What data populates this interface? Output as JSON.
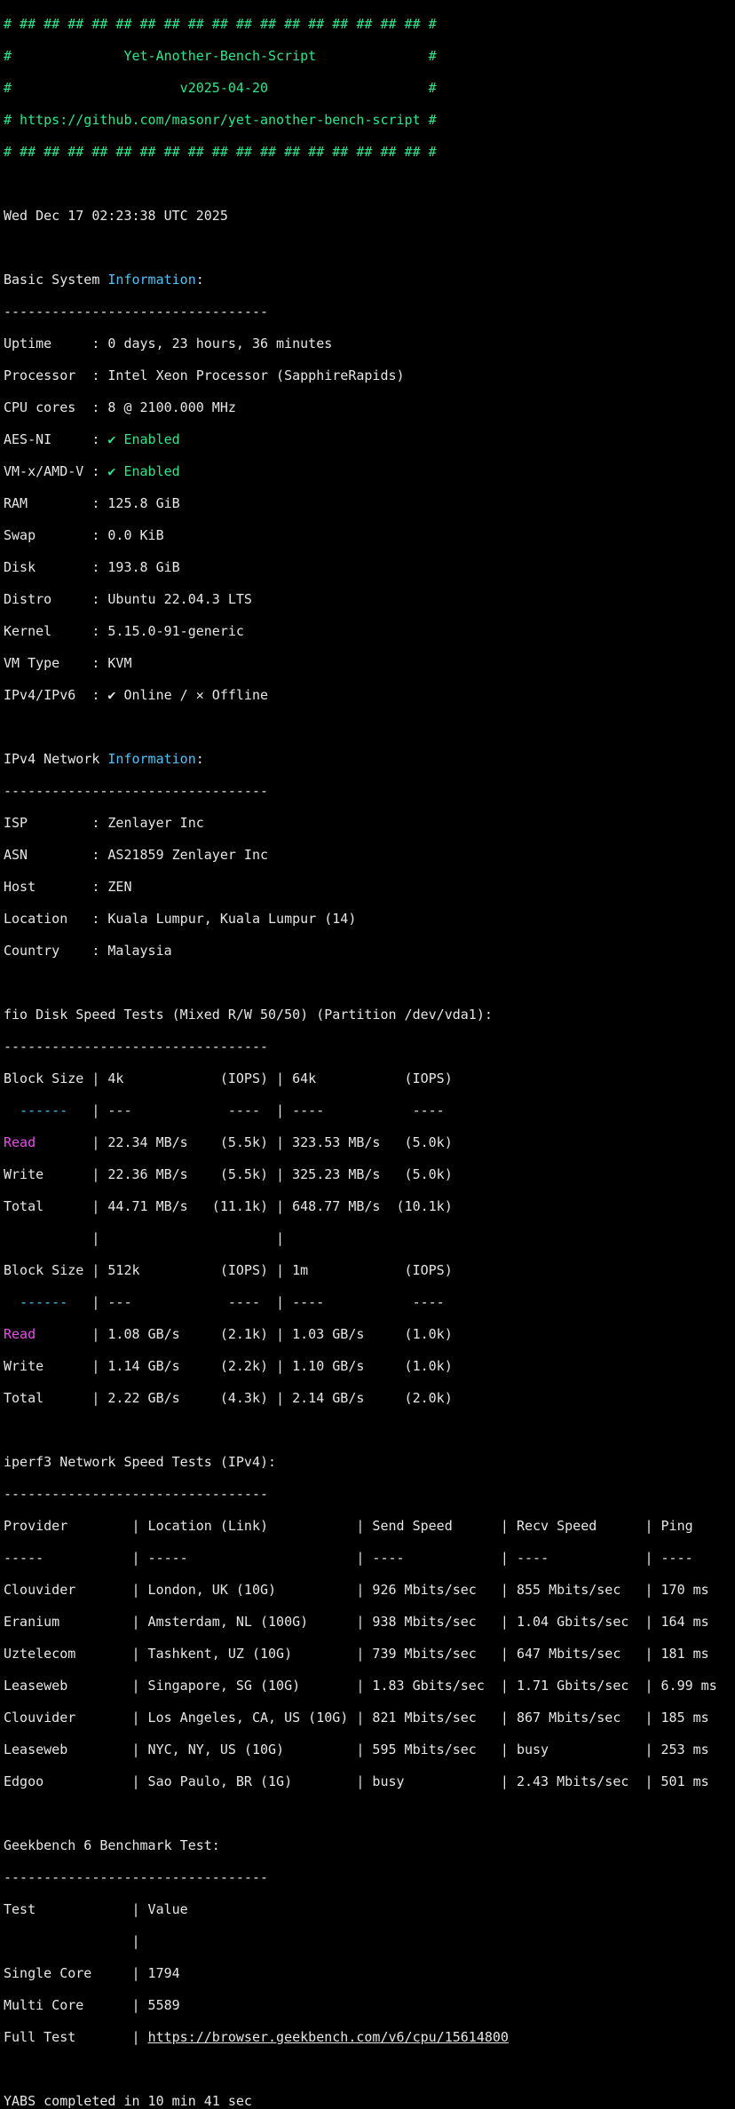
{
  "banner": {
    "border": "# ## ## ## ## ## ## ## ## ## ## ## ## ## ## ## ## ## #",
    "title_line": "#              Yet-Another-Bench-Script              #",
    "version_line": "#                     v2025-04-20                    #",
    "url_line": "# https://github.com/masonr/yet-another-bench-script #"
  },
  "date": "Wed Dec 17 02:23:38 UTC 2025",
  "separator": "---------------------------------",
  "basic": {
    "heading_prefix": "Basic System ",
    "heading_highlight": "Information",
    "heading_suffix": ":",
    "rows": [
      {
        "label": "Uptime     : ",
        "value": "0 days, 23 hours, 36 minutes"
      },
      {
        "label": "Processor  : ",
        "value": "Intel Xeon Processor (SapphireRapids)"
      },
      {
        "label": "CPU cores  : ",
        "value": "8 @ 2100.000 MHz"
      },
      {
        "label": "AES-NI     : ",
        "value": "✔ Enabled"
      },
      {
        "label": "VM-x/AMD-V : ",
        "value": "✔ Enabled"
      },
      {
        "label": "RAM        : ",
        "value": "125.8 GiB"
      },
      {
        "label": "Swap       : ",
        "value": "0.0 KiB"
      },
      {
        "label": "Disk       : ",
        "value": "193.8 GiB"
      },
      {
        "label": "Distro     : ",
        "value": "Ubuntu 22.04.3 LTS"
      },
      {
        "label": "Kernel     : ",
        "value": "5.15.0-91-generic"
      },
      {
        "label": "VM Type    : ",
        "value": "KVM"
      },
      {
        "label": "IPv4/IPv6  : ",
        "value": "✔ Online / ✕ Offline"
      }
    ]
  },
  "network": {
    "heading_prefix": "IPv4 Network ",
    "heading_highlight": "Information",
    "heading_suffix": ":",
    "rows": [
      {
        "label": "ISP        : ",
        "value": "Zenlayer Inc"
      },
      {
        "label": "ASN        : ",
        "value": "AS21859 Zenlayer Inc"
      },
      {
        "label": "Host       : ",
        "value": "ZEN"
      },
      {
        "label": "Location   : ",
        "value": "Kuala Lumpur, Kuala Lumpur (14)"
      },
      {
        "label": "Country    : ",
        "value": "Malaysia"
      }
    ]
  },
  "fio": {
    "heading": "fio Disk Speed Tests (Mixed R/W 50/50) (Partition /dev/vda1):",
    "header1": "Block Size | 4k            (IOPS) | 64k           (IOPS)",
    "dash1a": "  ------   ",
    "dash1b": "| ---            ----  | ----           ---- ",
    "read1_label": "Read",
    "read1_rest": "       | 22.34 MB/s    (5.5k) | 323.53 MB/s   (5.0k)",
    "write1": "Write      | 22.36 MB/s    (5.5k) | 325.23 MB/s   (5.0k)",
    "total1": "Total      | 44.71 MB/s   (11.1k) | 648.77 MB/s  (10.1k)",
    "spacer": "           |                      |",
    "header2": "Block Size | 512k          (IOPS) | 1m            (IOPS)",
    "dash2a": "  ------   ",
    "dash2b": "| ---            ----  | ----           ---- ",
    "read2_label": "Read",
    "read2_rest": "       | 1.08 GB/s     (2.1k) | 1.03 GB/s     (1.0k)",
    "write2": "Write      | 1.14 GB/s     (2.2k) | 1.10 GB/s     (1.0k)",
    "total2": "Total      | 2.22 GB/s     (4.3k) | 2.14 GB/s     (2.0k)"
  },
  "iperf": {
    "heading": "iperf3 Network Speed Tests (IPv4):",
    "header": "Provider        | Location (Link)           | Send Speed      | Recv Speed      | Ping",
    "dash_a": "-----           ",
    "dash_b": "| -----                     | ----            | ----            | ----",
    "rows": [
      "Clouvider       | London, UK (10G)          | 926 Mbits/sec   | 855 Mbits/sec   | 170 ms",
      "Eranium         | Amsterdam, NL (100G)      | 938 Mbits/sec   | 1.04 Gbits/sec  | 164 ms",
      "Uztelecom       | Tashkent, UZ (10G)        | 739 Mbits/sec   | 647 Mbits/sec   | 181 ms",
      "Leaseweb        | Singapore, SG (10G)       | 1.83 Gbits/sec  | 1.71 Gbits/sec  | 6.99 ms",
      "Clouvider       | Los Angeles, CA, US (10G) | 821 Mbits/sec   | 867 Mbits/sec   | 185 ms",
      "Leaseweb        | NYC, NY, US (10G)         | 595 Mbits/sec   | busy            | 253 ms",
      "Edgoo           | Sao Paulo, BR (1G)        | busy            | 2.43 Mbits/sec  | 501 ms"
    ]
  },
  "geekbench": {
    "heading": "Geekbench 6 Benchmark Test:",
    "header": "Test            | Value",
    "spacer": "                |",
    "single": "Single Core     | 1794",
    "multi": "Multi Core      | 5589",
    "full_prefix": "Full Test       | ",
    "full_link": "https://browser.geekbench.com/v6/cpu/15614800"
  },
  "footer": "YABS completed in 10 min 41 sec",
  "colors": {
    "background": "#000000",
    "text": "#e6e6e6",
    "banner_green": "#2ee68a",
    "info_blue": "#4fc3f7",
    "read_magenta": "#e84fe8"
  }
}
